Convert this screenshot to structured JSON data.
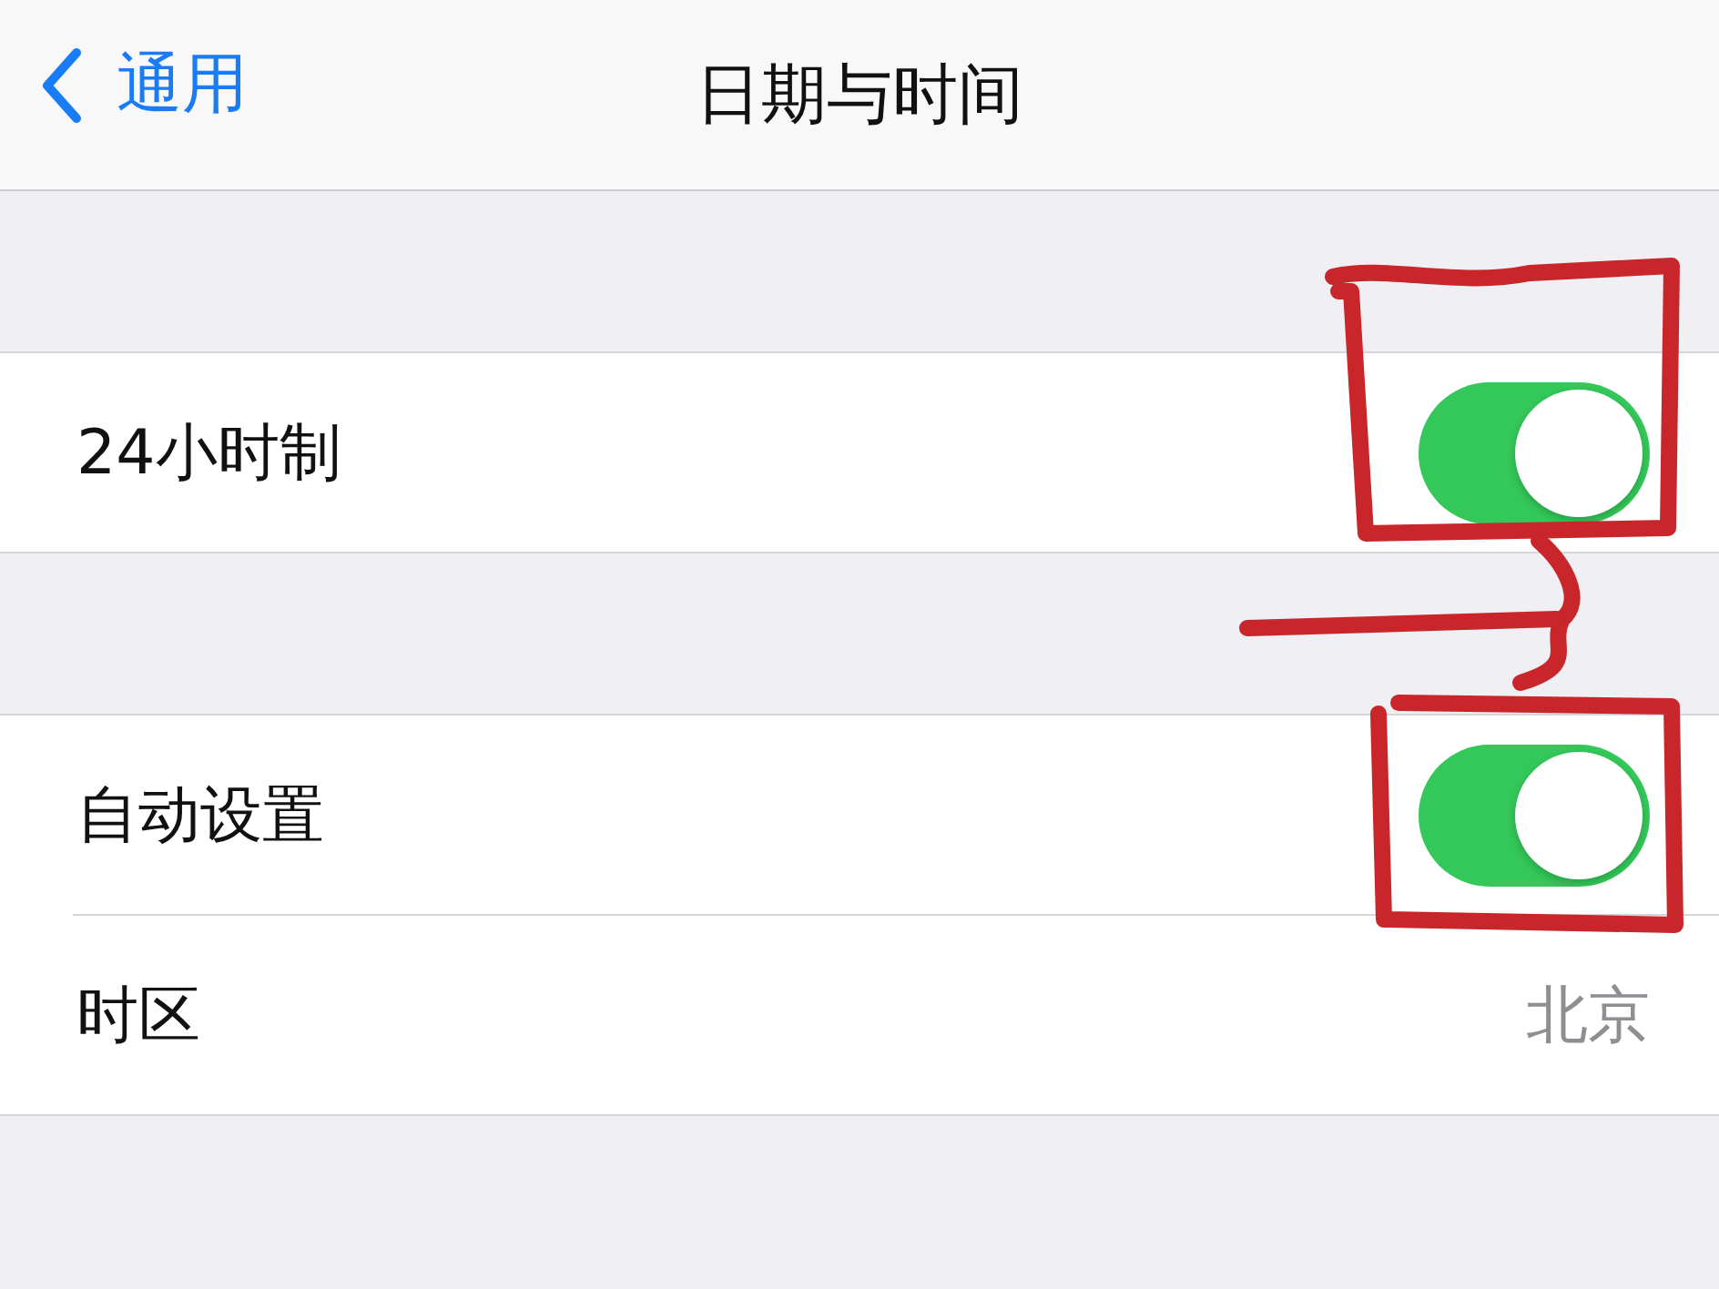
{
  "nav": {
    "back_label": "通用",
    "title": "日期与时间"
  },
  "sections": [
    {
      "rows": [
        {
          "kind": "toggle",
          "label": "24小时制",
          "on": true
        }
      ]
    },
    {
      "rows": [
        {
          "kind": "toggle",
          "label": "自动设置",
          "on": true
        },
        {
          "kind": "value",
          "label": "时区",
          "value": "北京"
        }
      ]
    }
  ]
}
